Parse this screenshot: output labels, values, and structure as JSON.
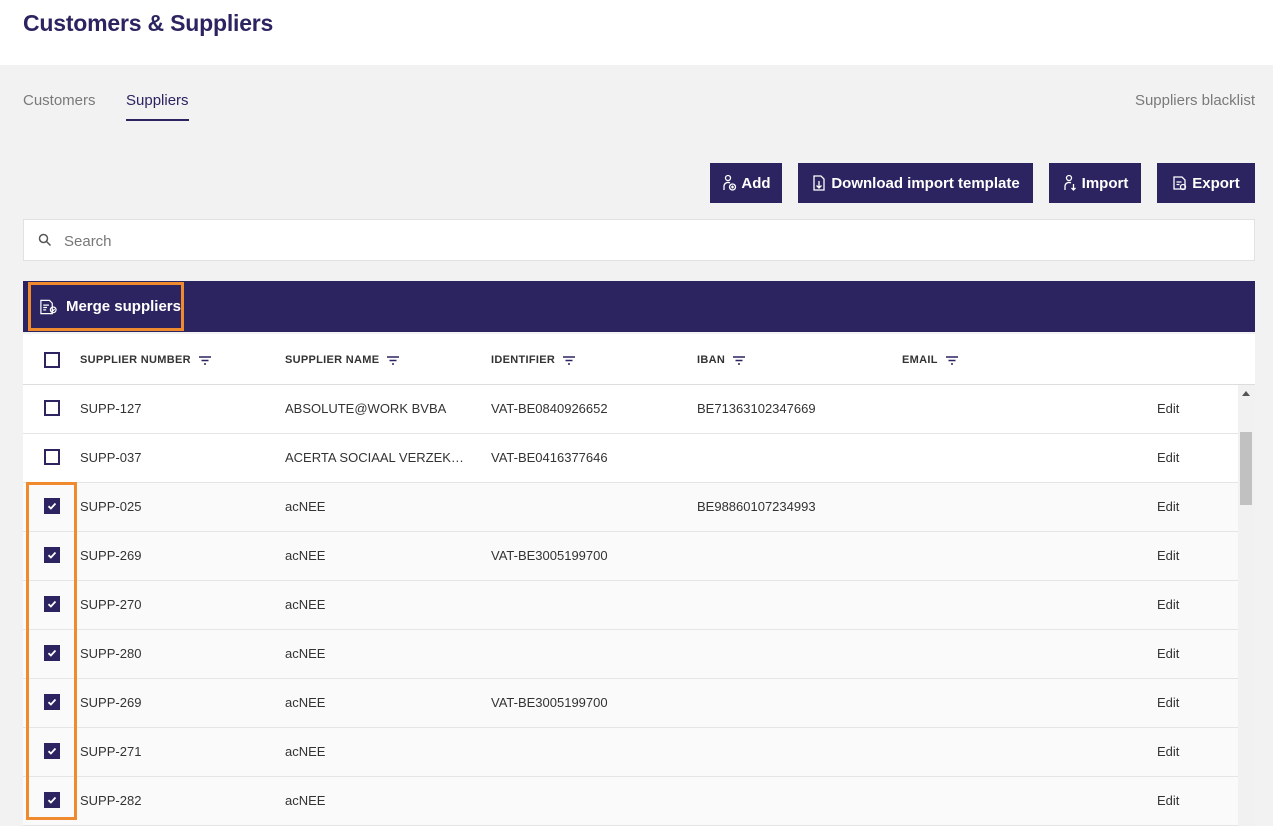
{
  "page": {
    "title": "Customers & Suppliers"
  },
  "tabs": [
    {
      "label": "Customers",
      "active": false
    },
    {
      "label": "Suppliers",
      "active": true
    }
  ],
  "blacklist_link": "Suppliers blacklist",
  "actions": {
    "add": {
      "label": "Add",
      "icon": "add-person-icon"
    },
    "download": {
      "label": "Download import template",
      "icon": "download-file-icon"
    },
    "import": {
      "label": "Import",
      "icon": "import-person-icon"
    },
    "export": {
      "label": "Export",
      "icon": "export-file-icon"
    }
  },
  "search": {
    "placeholder": "Search",
    "value": ""
  },
  "toolbar": {
    "merge_label": "Merge suppliers",
    "merge_icon": "merge-document-icon"
  },
  "table": {
    "columns": [
      "SUPPLIER NUMBER",
      "SUPPLIER NAME",
      "IDENTIFIER",
      "IBAN",
      "EMAIL"
    ],
    "edit_label": "Edit",
    "rows": [
      {
        "checked": false,
        "number": "SUPP-127",
        "name": "ABSOLUTE@WORK BVBA",
        "identifier": "VAT-BE0840926652",
        "iban": "BE71363102347669",
        "email": ""
      },
      {
        "checked": false,
        "number": "SUPP-037",
        "name": "ACERTA SOCIAAL VERZEKERINGSFONDS",
        "identifier": "VAT-BE0416377646",
        "iban": "",
        "email": ""
      },
      {
        "checked": true,
        "number": "SUPP-025",
        "name": "acNEE",
        "identifier": "",
        "iban": "BE98860107234993",
        "email": ""
      },
      {
        "checked": true,
        "number": "SUPP-269",
        "name": "acNEE",
        "identifier": "VAT-BE3005199700",
        "iban": "",
        "email": ""
      },
      {
        "checked": true,
        "number": "SUPP-270",
        "name": "acNEE",
        "identifier": "",
        "iban": "",
        "email": ""
      },
      {
        "checked": true,
        "number": "SUPP-280",
        "name": "acNEE",
        "identifier": "",
        "iban": "",
        "email": ""
      },
      {
        "checked": true,
        "number": "SUPP-269",
        "name": "acNEE",
        "identifier": "VAT-BE3005199700",
        "iban": "",
        "email": ""
      },
      {
        "checked": true,
        "number": "SUPP-271",
        "name": "acNEE",
        "identifier": "",
        "iban": "",
        "email": ""
      },
      {
        "checked": true,
        "number": "SUPP-282",
        "name": "acNEE",
        "identifier": "",
        "iban": "",
        "email": ""
      }
    ]
  },
  "colors": {
    "primary": "#2b2460",
    "highlight": "#f08a2e",
    "background": "#f2f2f2"
  }
}
